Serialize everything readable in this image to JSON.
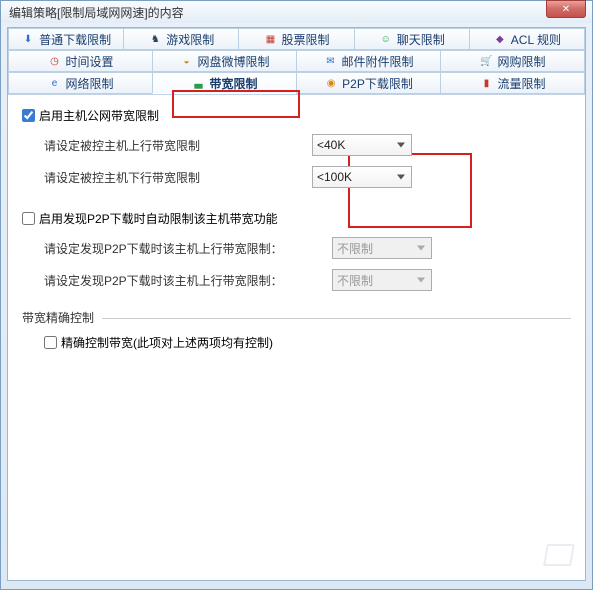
{
  "window": {
    "title": "编辑策略[限制局域网网速]的内容",
    "close": "✕"
  },
  "tabs": {
    "row1": [
      {
        "icon": "⬇",
        "cls": "ico-blue",
        "name": "tab-download",
        "label": "普通下载限制"
      },
      {
        "icon": "♞",
        "cls": "ico-dark",
        "name": "tab-game",
        "label": "游戏限制"
      },
      {
        "icon": "▦",
        "cls": "ico-red",
        "name": "tab-stock",
        "label": "股票限制"
      },
      {
        "icon": "☺",
        "cls": "ico-green",
        "name": "tab-chat",
        "label": "聊天限制"
      },
      {
        "icon": "◆",
        "cls": "ico-purple",
        "name": "tab-acl",
        "label": "ACL 规则"
      }
    ],
    "row2": [
      {
        "icon": "◷",
        "cls": "ico-red",
        "name": "tab-time",
        "label": "时间设置"
      },
      {
        "icon": "◒",
        "cls": "ico-orange",
        "name": "tab-netdisk",
        "label": "网盘微博限制"
      },
      {
        "icon": "✉",
        "cls": "ico-blue",
        "name": "tab-mail",
        "label": "邮件附件限制"
      },
      {
        "icon": "🛒",
        "cls": "ico-dark",
        "name": "tab-shop",
        "label": "网购限制"
      }
    ],
    "row3": [
      {
        "icon": "e",
        "cls": "ico-blue",
        "name": "tab-net",
        "label": "网络限制"
      },
      {
        "icon": "▃",
        "cls": "ico-green",
        "name": "tab-bandwidth",
        "label": "带宽限制",
        "active": true
      },
      {
        "icon": "◉",
        "cls": "ico-orange",
        "name": "tab-p2p",
        "label": "P2P下载限制"
      },
      {
        "icon": "▮",
        "cls": "ico-red",
        "name": "tab-traffic",
        "label": "流量限制"
      }
    ]
  },
  "form": {
    "enable_public_bw": {
      "checked": true,
      "label": "启用主机公网带宽限制"
    },
    "uplink_label": "请设定被控主机上行带宽限制",
    "uplink_value": "<40K",
    "downlink_label": "请设定被控主机下行带宽限制",
    "downlink_value": "<100K",
    "auto_p2p": {
      "checked": false,
      "label": "启用发现P2P下载时自动限制该主机带宽功能"
    },
    "p2p_down_label": "请设定发现P2P下载时该主机上行带宽限制：",
    "p2p_down_value": "不限制",
    "p2p_up_label": "请设定发现P2P下载时该主机上行带宽限制：",
    "p2p_up_value": "不限制",
    "precise_section": "带宽精确控制",
    "precise": {
      "checked": false,
      "label": "精确控制带宽(此项对上述两项均有控制)"
    }
  }
}
